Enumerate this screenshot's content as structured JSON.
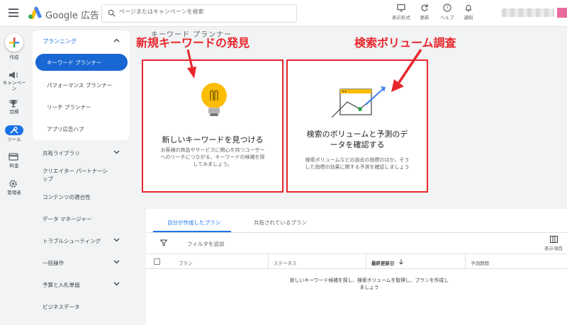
{
  "header": {
    "brand": "Google 広告",
    "search_placeholder": "ページまたはキャンペーンを検索",
    "buttons": [
      {
        "label": "表示形式",
        "icon": "appearance-icon"
      },
      {
        "label": "更新",
        "icon": "refresh-icon"
      },
      {
        "label": "ヘルプ",
        "icon": "help-icon"
      },
      {
        "label": "通知",
        "icon": "bell-icon"
      }
    ]
  },
  "rail": {
    "items": [
      {
        "label": "作成",
        "icon": "plus-icon"
      },
      {
        "label": "キャンペーン",
        "icon": "megaphone-icon"
      },
      {
        "label": "目標",
        "icon": "trophy-icon"
      },
      {
        "label": "ツール",
        "icon": "tools-icon"
      },
      {
        "label": "料金",
        "icon": "card-icon"
      },
      {
        "label": "管理者",
        "icon": "gear-icon"
      }
    ]
  },
  "nav": {
    "section": "プランニング",
    "active": "キーワード プランナー",
    "sub_items": [
      "パフォーマンス プランナー",
      "リーチ プランナー",
      "アプリ広告ハブ"
    ],
    "items": [
      {
        "label": "共有ライブラリ",
        "chevron": true
      },
      {
        "label": "クリエイター パートナーシップ",
        "chevron": false
      },
      {
        "label": "コンテンツの適合性",
        "chevron": false
      },
      {
        "label": "データ マネージャー",
        "chevron": false
      },
      {
        "label": "トラブルシューティング",
        "chevron": true
      },
      {
        "label": "一括操作",
        "chevron": true
      },
      {
        "label": "予算と入札単価",
        "chevron": true
      },
      {
        "label": "ビジネスデータ",
        "chevron": false
      }
    ]
  },
  "main": {
    "page_title": "キーワード プランナー",
    "cards": [
      {
        "title": "新しいキーワードを見つける",
        "desc_line1": "お客様の商品やサービスに関心を持つユーザー",
        "desc_line2": "へのリーチにつながる、キーワードの候補を探",
        "desc_line3": "してみましょう。",
        "annotation": "新規キーワードの発見"
      },
      {
        "title_line1": "検索のボリュームと予測のデ",
        "title_line2": "ータを確認する",
        "desc_line1": "検索ボリュームなどの過去の指標のほか、そう",
        "desc_line2": "した指標の効果に関する予測を確認しましょう",
        "annotation": "検索ボリューム調査"
      }
    ]
  },
  "plans": {
    "tabs": [
      "自分が作成したプラン",
      "共有されているプラン"
    ],
    "filter_label": "フィルタを追加",
    "columns_label": "表示項目",
    "headers": [
      "プラン",
      "ステータス",
      "最終更新日",
      "予測期間"
    ],
    "empty_line1": "新しいキーワード候補を探し、検索ボリュームを取得し、プランを作成し",
    "empty_line2": "ましょう"
  },
  "colors": {
    "accent": "#1a73e8",
    "annotation_red": "#e8262b",
    "bulb_yellow": "#fbbc04"
  }
}
